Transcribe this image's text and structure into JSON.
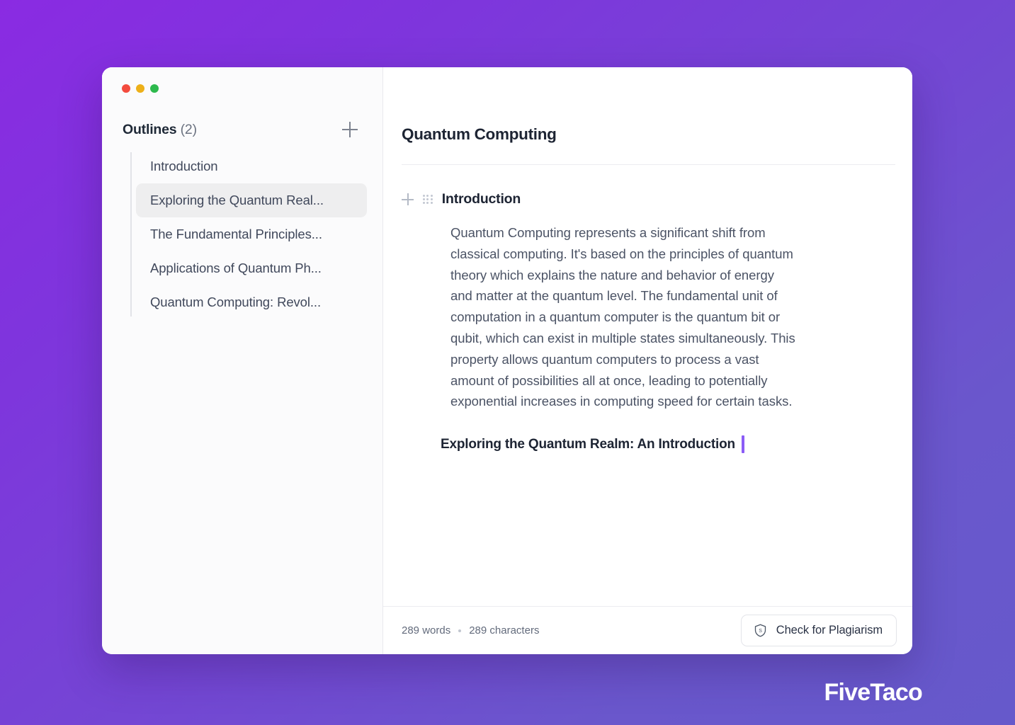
{
  "background": {
    "gradient_from": "#8a2be2",
    "gradient_to": "#6659cb"
  },
  "window": {
    "traffic_lights": [
      {
        "name": "close",
        "color": "#f34b3e"
      },
      {
        "name": "minimize",
        "color": "#edb019"
      },
      {
        "name": "maximize",
        "color": "#2db94d"
      }
    ]
  },
  "sidebar": {
    "title": "Outlines",
    "count": "(2)",
    "add_button_icon": "plus-icon",
    "items": [
      {
        "label": "Introduction",
        "selected": false
      },
      {
        "label": "Exploring the Quantum Real...",
        "selected": true
      },
      {
        "label": "The Fundamental Principles...",
        "selected": false
      },
      {
        "label": "Applications of Quantum Ph...",
        "selected": false
      },
      {
        "label": "Quantum Computing: Revol...",
        "selected": false
      }
    ]
  },
  "document": {
    "title": "Quantum Computing",
    "section": {
      "add_icon": "plus-icon",
      "drag_icon": "grip-dots-icon",
      "heading": "Introduction",
      "paragraph": "Quantum Computing represents a significant shift from classical computing. It's based on the principles of quantum theory which explains the nature and behavior of energy and matter at the quantum level. The fundamental unit of computation in a quantum computer is the quantum bit or qubit, which can exist in multiple states simultaneously. This property allows quantum computers to process a vast amount of possibilities all at once, leading to potentially exponential increases in computing speed for certain tasks.",
      "subheading": "Exploring the Quantum Realm: An Introduction",
      "caret_color": "#8b5cf6"
    }
  },
  "footer": {
    "words": "289 words",
    "characters": "289 characters",
    "plagiarism_button": {
      "label": "Check for Plagiarism",
      "icon": "shield-icon"
    }
  },
  "brand": {
    "name": "FiveTaco"
  }
}
